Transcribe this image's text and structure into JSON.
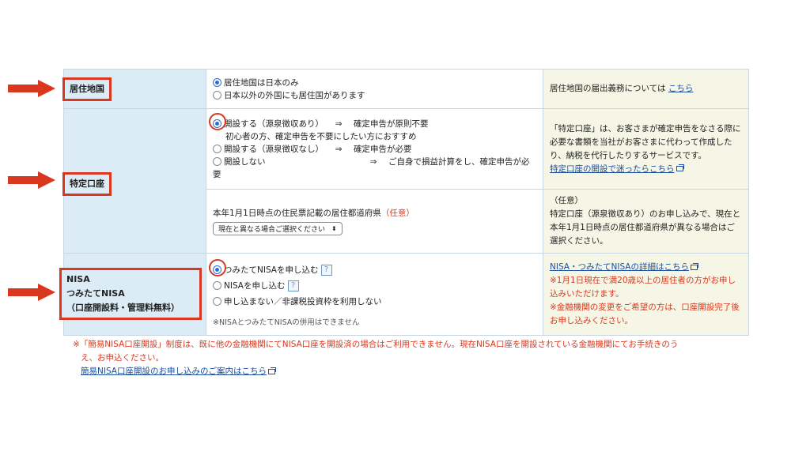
{
  "residence": {
    "label": "居住地国",
    "options": [
      "居住地国は日本のみ",
      "日本以外の外国にも居住国があります"
    ],
    "info_text": "居住地国の届出義務については",
    "info_link": "こちら"
  },
  "tokutei": {
    "label": "特定口座",
    "opt1": "開設する（源泉徴収あり）",
    "opt1_arrow": "⇒",
    "opt1_result": "確定申告が原則不要",
    "opt1_sub": "初心者の方、確定申告を不要にしたい方におすすめ",
    "opt2": "開設する（源泉徴収なし）",
    "opt2_arrow": "⇒",
    "opt2_result": "確定申告が必要",
    "opt3": "開設しない",
    "opt3_arrow": "⇒",
    "opt3_result": "ご自身で損益計算をし、確定申告が必",
    "opt3_result2": "要",
    "info": "「特定口座」は、お客さまが確定申告をなさる際に必要な書類を当社がお客さまに代わって作成したり、納税を代行したりするサービスです。",
    "info_link": "特定口座の開設で迷ったらこちら",
    "pref_label": "本年1月1日時点の住民票記載の居住都道府県",
    "pref_optional": "（任意）",
    "select_value": "現在と異なる場合ご選択ください",
    "pref_info_title": "（任意）",
    "pref_info": "特定口座（源泉徴収あり）のお申し込みで、現在と本年1月1日時点の居住都道府県が異なる場合はご選択ください。"
  },
  "nisa": {
    "label_line1": "NISA",
    "label_line2": "つみたてNISA",
    "label_line3": "（口座開設料・管理料無料）",
    "opt1": "つみたてNISAを申し込む",
    "opt2": "NISAを申し込む",
    "opt3": "申し込まない／非課税投資枠を利用しない",
    "help": "?",
    "footnote": "※NISAとつみたてNISAの併用はできません",
    "info_link": "NISA・つみたてNISAの詳細はこちら",
    "info_note1": "※1月1日現在で満20歳以上の居住者の方がお申し込みいただけます。",
    "info_note2": "※金融機関の変更をご希望の方は、口座開設完了後お申し込みください。"
  },
  "bottom_note": {
    "line1": "※「簡易NISA口座開設」制度は、既に他の金融機関にてNISA口座を開設済の場合はご利用できません。現在NISA口座を開設されている金融機関にてお手続きのう",
    "line2": "え、お申込ください。",
    "link": "簡易NISA口座開設のお申し込みのご案内はこちら"
  },
  "colors": {
    "annotation": "#d9381e",
    "label_bg": "#dcecf7",
    "info_bg": "#f6f6e6",
    "link": "#1d4fa0"
  }
}
